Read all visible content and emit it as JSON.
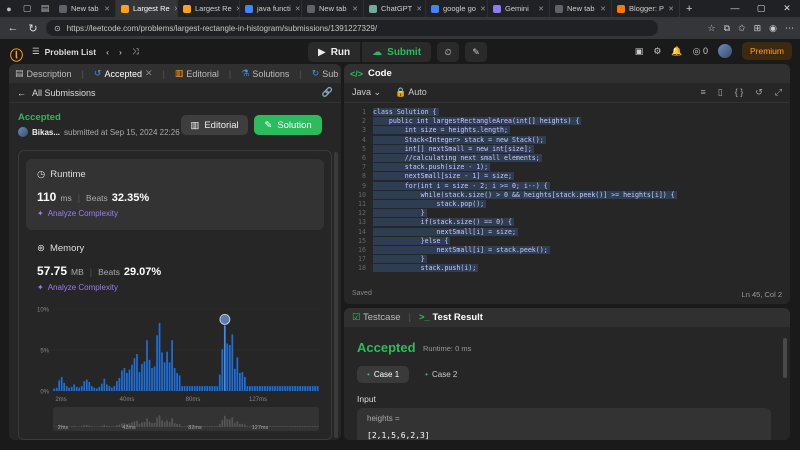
{
  "browser": {
    "tabs": [
      {
        "label": "New tab",
        "color": "#5f6368",
        "active": false
      },
      {
        "label": "Largest Re",
        "color": "#ffa116",
        "active": true
      },
      {
        "label": "Largest Re",
        "color": "#ffa116",
        "active": false
      },
      {
        "label": "java functi",
        "color": "#4285f4",
        "active": false
      },
      {
        "label": "New tab",
        "color": "#5f6368",
        "active": false
      },
      {
        "label": "ChatGPT",
        "color": "#74aa9c",
        "active": false
      },
      {
        "label": "google go",
        "color": "#4285f4",
        "active": false
      },
      {
        "label": "Gemini",
        "color": "#8e7cf7",
        "active": false
      },
      {
        "label": "New tab",
        "color": "#5f6368",
        "active": false
      },
      {
        "label": "Blogger: P",
        "color": "#f57c00",
        "active": false
      }
    ],
    "url": "https://leetcode.com/problems/largest-rectangle-in-histogram/submissions/1391227329/"
  },
  "header": {
    "problem_list": "Problem List",
    "run": "Run",
    "submit": "Submit",
    "coins": "0",
    "premium": "Premium"
  },
  "left_tabs": {
    "description": "Description",
    "accepted": "Accepted",
    "editorial": "Editorial",
    "solutions": "Solutions",
    "submissions": "Sub"
  },
  "submission": {
    "back_label": "All Submissions",
    "status": "Accepted",
    "user": "Bikas...",
    "submitted_at": "submitted at Sep 15, 2024 22:26",
    "editorial_btn": "Editorial",
    "solution_btn": "Solution"
  },
  "runtime": {
    "title": "Runtime",
    "value": "110",
    "unit": "ms",
    "beats_label": "Beats",
    "beats": "32.35%",
    "analyze": "Analyze Complexity"
  },
  "memory": {
    "title": "Memory",
    "value": "57.75",
    "unit": "MB",
    "beats_label": "Beats",
    "beats": "29.07%",
    "analyze": "Analyze Complexity"
  },
  "chart_data": {
    "type": "bar",
    "yticks": [
      "10%",
      "5%",
      "0%"
    ],
    "ylim": [
      0,
      10
    ],
    "xticks": [
      "2ms",
      "40ms",
      "80ms",
      "127ms"
    ],
    "mini_xticks": [
      "2ms",
      "42ms",
      "82ms",
      "127ms"
    ],
    "values": [
      0.3,
      0.4,
      1.3,
      1.7,
      1.0,
      0.6,
      0.4,
      0.5,
      0.8,
      0.5,
      0.4,
      0.6,
      1.2,
      1.4,
      1.1,
      0.6,
      0.4,
      0.3,
      0.5,
      0.9,
      1.5,
      0.8,
      0.6,
      0.4,
      0.6,
      1.2,
      1.6,
      2.5,
      2.8,
      2.2,
      2.6,
      3.2,
      4.0,
      4.5,
      2.3,
      3.3,
      3.6,
      6.2,
      3.8,
      2.8,
      3.0,
      6.8,
      8.3,
      4.7,
      3.5,
      4.8,
      3.5,
      6.2,
      2.8,
      2.2,
      1.9,
      0.6,
      0.6,
      0.6,
      0.6,
      0.6,
      0.6,
      0.6,
      0.6,
      0.6,
      0.6,
      0.6,
      0.6,
      0.6,
      0.6,
      0.6,
      2.0,
      5.1,
      8.0,
      5.8,
      5.6,
      6.9,
      2.7,
      4.1,
      2.2,
      2.3,
      1.7,
      0.6,
      0.6,
      0.6,
      0.6,
      0.6,
      0.6,
      0.6,
      0.6,
      0.6,
      0.6,
      0.6,
      0.6,
      0.6,
      0.6,
      0.6,
      0.6,
      0.6,
      0.6,
      0.6,
      0.6,
      0.6,
      0.6,
      0.6,
      0.6,
      0.6,
      0.6,
      0.6,
      0.6,
      0.6
    ],
    "highlight_index": 68,
    "bar_color": "#1e6fd9",
    "highlight_color": "#3d8ef0"
  },
  "code": {
    "title": "Code",
    "language": "Java",
    "mode": "Auto",
    "saved": "Saved",
    "cursor": "Ln 45, Col 2",
    "lines": [
      {
        "n": "1",
        "t": "class Solution {"
      },
      {
        "n": "2",
        "t": "    public int largestRectangleArea(int[] heights) {"
      },
      {
        "n": "3",
        "t": "        int size = heights.length;"
      },
      {
        "n": "4",
        "t": "        Stack<Integer> stack = new Stack();"
      },
      {
        "n": "5",
        "t": "        int[] nextSmall = new int[size];"
      },
      {
        "n": "6",
        "t": "        //calculating next small elements;"
      },
      {
        "n": "7",
        "t": "        stack.push(size - 1);"
      },
      {
        "n": "8",
        "t": "        nextSmall[size - 1] = size;"
      },
      {
        "n": "9",
        "t": "        for(int i = size - 2; i >= 0; i--) {"
      },
      {
        "n": "10",
        "t": "            while(stack.size() > 0 && heights[stack.peek()] >= heights[i]) {"
      },
      {
        "n": "11",
        "t": "                stack.pop();"
      },
      {
        "n": "12",
        "t": "            }"
      },
      {
        "n": "13",
        "t": "            if(stack.size() == 0) {"
      },
      {
        "n": "14",
        "t": "                nextSmall[i] = size;"
      },
      {
        "n": "15",
        "t": "            }else {"
      },
      {
        "n": "16",
        "t": "                nextSmall[i] = stack.peek();"
      },
      {
        "n": "17",
        "t": "            }"
      },
      {
        "n": "18",
        "t": "            stack.push(i);"
      }
    ]
  },
  "result": {
    "testcase_tab": "Testcase",
    "result_tab": "Test Result",
    "status": "Accepted",
    "runtime": "Runtime: 0 ms",
    "case1": "Case 1",
    "case2": "Case 2",
    "input_label": "Input",
    "param_name": "heights =",
    "param_value": "[2,1,5,6,2,3]"
  }
}
